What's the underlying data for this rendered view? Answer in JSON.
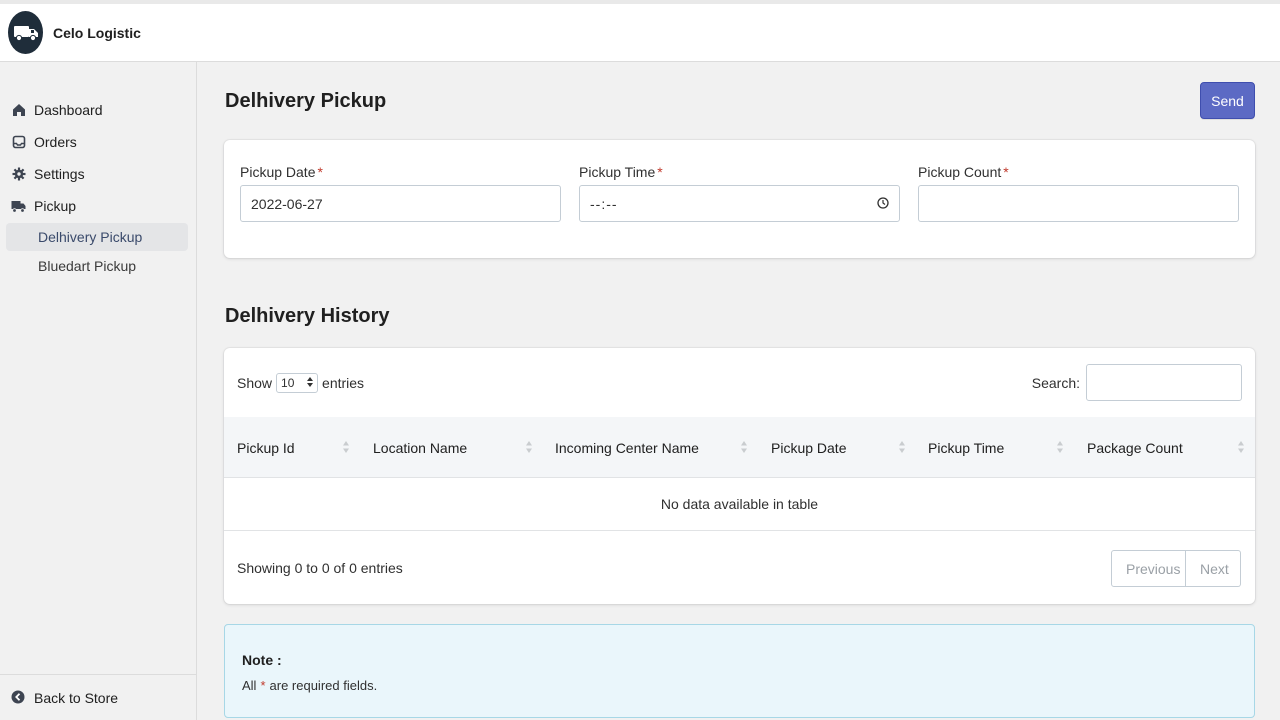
{
  "app": {
    "name": "Celo Logistic"
  },
  "sidebar": {
    "items": [
      {
        "label": "Dashboard",
        "icon": "home-icon"
      },
      {
        "label": "Orders",
        "icon": "inbox-icon"
      },
      {
        "label": "Settings",
        "icon": "gear-icon"
      },
      {
        "label": "Pickup",
        "icon": "truck-icon"
      }
    ],
    "subitems": [
      {
        "label": "Delhivery Pickup",
        "active": true
      },
      {
        "label": "Bluedart Pickup",
        "active": false
      }
    ],
    "footer": {
      "label": "Back to Store",
      "icon": "arrow-left-circle-icon"
    }
  },
  "page": {
    "title": "Delhivery Pickup",
    "send_label": "Send",
    "form": {
      "pickup_date": {
        "label": "Pickup Date",
        "required": "*",
        "value": "2022-06-27"
      },
      "pickup_time": {
        "label": "Pickup Time",
        "required": "*",
        "value": "--:--"
      },
      "pickup_count": {
        "label": "Pickup Count",
        "required": "*",
        "value": ""
      }
    }
  },
  "history": {
    "title": "Delhivery History",
    "show_label": "Show",
    "entries_label": "entries",
    "length_value": "10",
    "search_label": "Search:",
    "columns": [
      "Pickup Id",
      "Location Name",
      "Incoming Center Name",
      "Pickup Date",
      "Pickup Time",
      "Package Count"
    ],
    "empty_text": "No data available in table",
    "info_text": "Showing 0 to 0 of 0 entries",
    "prev_label": "Previous",
    "next_label": "Next"
  },
  "note": {
    "title": "Note :",
    "text_before": "All",
    "required_mark": "*",
    "text_after": "are required fields."
  },
  "colors": {
    "primary": "#5c6ac4",
    "required": "#c0392b",
    "note_bg": "#eaf6fb"
  }
}
